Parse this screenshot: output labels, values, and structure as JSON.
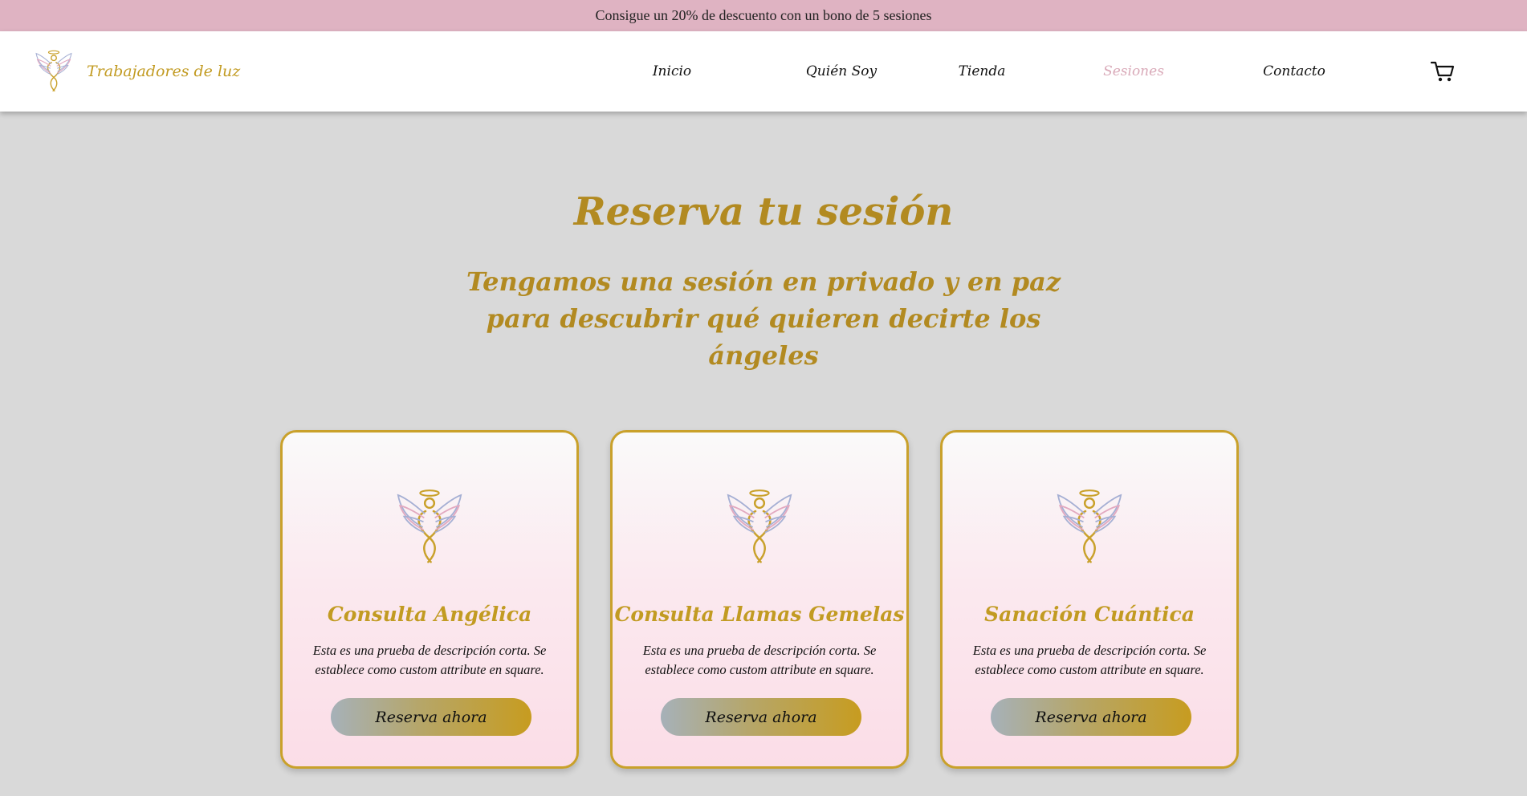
{
  "promo": {
    "text": "Consigue un 20% de descuento con un bono de 5 sesiones"
  },
  "header": {
    "brand_name": "Trabajadores de luz",
    "brand_logo_icon": "angel-wings-logo-icon",
    "nav": [
      {
        "label": "Inicio",
        "active": false
      },
      {
        "label": "Quién Soy",
        "active": false
      },
      {
        "label": "Tienda",
        "active": false
      },
      {
        "label": "Sesiones",
        "active": true
      },
      {
        "label": "Contacto",
        "active": false
      }
    ],
    "cart_icon": "shopping-cart-icon"
  },
  "hero": {
    "title": "Reserva tu sesión",
    "subtitle": "Tengamos una sesión en privado y en paz para descubrir qué quieren decirte los ángeles"
  },
  "cards": [
    {
      "title": "Consulta Angélica",
      "description": "Esta es una prueba de descripción corta. Se establece como custom attribute en square.",
      "button_label": "Reserva ahora"
    },
    {
      "title": "Consulta Llamas Gemelas",
      "description": "Esta es una prueba de descripción corta. Se establece como custom attribute en square.",
      "button_label": "Reserva ahora"
    },
    {
      "title": "Sanación Cuántica",
      "description": "Esta es una prueba de descripción corta. Se establece como custom attribute en square.",
      "button_label": "Reserva ahora"
    }
  ],
  "colors": {
    "promo_bg": "#dfb3c2",
    "gold": "#c29b22",
    "active_nav": "#d9a9b8",
    "page_bg": "#d9d9d9"
  }
}
